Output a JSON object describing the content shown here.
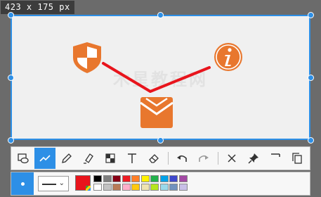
{
  "size_readout": "423 x 175  px",
  "annotation_color": "#e8141c",
  "icon_color": "#e8772e",
  "watermark_text": "木星教程网",
  "toolbar": {
    "tools": [
      {
        "name": "rectangle-ellipse-tool",
        "icon": "shapes-icon",
        "active": false
      },
      {
        "name": "line-tool",
        "icon": "polyline-icon",
        "active": true
      },
      {
        "name": "pencil-tool",
        "icon": "pencil-icon",
        "active": false
      },
      {
        "name": "marker-tool",
        "icon": "highlighter-icon",
        "active": false
      },
      {
        "name": "mosaic-tool",
        "icon": "mosaic-icon",
        "active": false
      },
      {
        "name": "text-tool",
        "icon": "text-icon",
        "active": false
      },
      {
        "name": "eraser-tool",
        "icon": "eraser-icon",
        "active": false
      },
      {
        "name": "undo-button",
        "icon": "undo-icon",
        "active": false
      },
      {
        "name": "redo-button",
        "icon": "redo-icon",
        "active": false
      },
      {
        "name": "cancel-button",
        "icon": "close-icon",
        "active": false
      },
      {
        "name": "pin-button",
        "icon": "pin-icon",
        "active": false
      },
      {
        "name": "save-button",
        "icon": "save-icon",
        "active": false
      },
      {
        "name": "copy-button",
        "icon": "copy-icon",
        "active": false
      }
    ]
  },
  "properties": {
    "line_style": "solid",
    "selected_color": "#e8141c",
    "palette": [
      "#000000",
      "#7f7f7f",
      "#880015",
      "#ed1c24",
      "#ff7f27",
      "#fff200",
      "#22b14c",
      "#00a2e8",
      "#3f48cc",
      "#a349a4",
      "#ffffff",
      "#c3c3c3",
      "#b97a57",
      "#ffaec9",
      "#ffc90e",
      "#efe4b0",
      "#b5e61d",
      "#99d9ea",
      "#7092be",
      "#c8bfe7"
    ]
  }
}
